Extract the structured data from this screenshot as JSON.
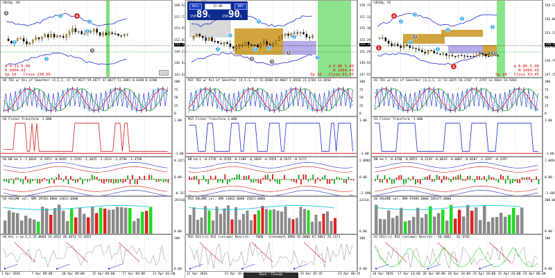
{
  "charts": [
    {
      "id": "left",
      "title": "GOLDg, H4",
      "main_prices": [
        "160.621",
        "157.730",
        "154.922",
        "152.073",
        "149.215",
        "146.425",
        "143.627"
      ],
      "current_price": "151.974",
      "overlay_left": [
        "$ 0.11 5.00",
        "H 1004.43",
        "Sp 10   Close 238.65"
      ],
      "overlay_right": [],
      "panes": [
        {
          "title": "H4 TDI w/ Rsi of Smoother (4,1,1, 3) 52.9677 59.4677 47.0677 51.2001 0.8200 0.6700",
          "scale": [
            "100",
            "75",
            "50",
            "25",
            "0"
          ]
        },
        {
          "title": "H4 Fisher Transform  -1.000",
          "scale": [
            "1.00",
            "-1.00"
          ]
        },
        {
          "title": "H4 BB km 1  -1.0941 -0.1951 -0.9495 -1.2292 -1.3825 -1.3523 -1.4796 -1.4796",
          "scale": [
            "0.3277",
            "0.00",
            "-0.3277"
          ]
        },
        {
          "title": "H4 VOLUME vol: SMA 29703.0000 33613.0000",
          "scale": [
            "397430.00",
            "0.00"
          ]
        },
        {
          "title": "H4 Rsi + sw 1,1 35.0000 54.4652 48.4652 52.4652",
          "scale": [
            "100",
            "0.00"
          ]
        }
      ],
      "time_labels": [
        "1 Apr 2026",
        "7 Apr 09:00",
        "10 Apr 09:00",
        "15 Apr 09:00",
        "17 Apr 09:00",
        "21 Apr 01:00"
      ]
    },
    {
      "id": "middle",
      "title": "GOLDg, M15",
      "main_prices": [
        "159.756",
        "157.130",
        "155.105",
        "153.290",
        "151.290",
        "149.915",
        "147.974"
      ],
      "current_price": "151.290",
      "overlay_left": [],
      "overlay_right": [
        "$ 0.86 5.00",
        "H 1004.43",
        "Sp 10   Close 63.45"
      ],
      "panes": [
        {
          "title": "M15 TDI w/ Rsi of Smoother (4,1,1, 3) 52.0588 42.0667 1.0556 21.6704 32.6950",
          "scale": [
            "100",
            "75",
            "50",
            "25",
            "0"
          ]
        },
        {
          "title": "M15 Fisher Transform  1.000",
          "scale": [
            "1.00",
            "-1.00"
          ]
        },
        {
          "title": "BB km 1  -0.2759 -0.3539 -0.1389 -0.3669 -0.5959 -0.5672 -0.5272",
          "scale": [
            "2.0902",
            "0.00",
            "-2.0902"
          ]
        },
        {
          "title": "M15 VOLUME vol: SMA 14662.0000 15021.0000",
          "scale": [
            "22154.00",
            "0.00"
          ]
        },
        {
          "title": "M15 RSI(rs) RSI (volume) Bearish: - TWOB - Greenmath EMDO 95.0000 67.9667 70.1171",
          "scale": [
            "100",
            "0.00"
          ]
        }
      ],
      "time_labels": [
        "22 Apr 2026",
        "22 Apr 16:45",
        "22 Apr 20:45",
        "23 Apr 01:45",
        "23 Apr 06:45"
      ],
      "trade_panel": {
        "sell_label": "SELL",
        "buy_label": "BUY",
        "lot": "12.00",
        "sell_prefix": "158",
        "sell_big": "89",
        "sell_sup": "1",
        "buy_prefix": "158",
        "buy_big": "90",
        "buy_sup": "1"
      },
      "tooltip": "Stick -- Change"
    },
    {
      "id": "right",
      "title": "GOLDg, H1",
      "main_prices": [
        "159.175",
        "156.005",
        "153.290",
        "151.290",
        "149.795",
        "147.150"
      ],
      "current_price": "150.415",
      "overlay_left": [],
      "overlay_right": [
        "$ 0.86 5.00",
        "H 1004.43",
        "Sp 10   Close 53.45"
      ],
      "panes": [
        {
          "title": "H1 TDI w/ Rsi of Smoother (4,1,1, 3) 53.1075 50.2707 -7.2797 12.9034 54.9364",
          "scale": [
            "100",
            "75",
            "50",
            "25",
            "0"
          ]
        },
        {
          "title": "H1 Fisher Transform  -1.000",
          "scale": [
            "1.00",
            "-1.00"
          ]
        },
        {
          "title": "BB km 1  -0.4780 -0.8955 -0.2239 -0.0633 -0.0007 -0.0507 -1.3397 -0.3297",
          "scale": [
            "2.0697",
            "0.00",
            "-2.0697"
          ]
        },
        {
          "title": "H4 VOLUME vol: SMA 97094.0000 105477.0000",
          "scale": [
            "200.00",
            "0.00"
          ]
        },
        {
          "title": "H1 RSI(rs) RSI (volume) Bearish - 58.4882 - 62.9701",
          "scale": [
            "100",
            "0.00"
          ]
        }
      ],
      "time_labels": [
        "16 Apr 2026",
        "17 Apr 13:00",
        "20 Apr 08:00",
        "20 Apr 18:00",
        "21 Apr 18:00",
        "22 Apr 20:00",
        "23 Apr 06:00"
      ]
    }
  ],
  "markers": {
    "red": [
      "4",
      "1",
      "1",
      "4"
    ],
    "blue_sample": "2",
    "gray_sample": "3"
  },
  "colors": {
    "candle_up": "#e8a11a",
    "candle_down": "#000000",
    "band_blue": "#1a2bd6",
    "band_cyan": "#18c8e0",
    "tdi_green": "#12a512",
    "tdi_red": "#d81a1a",
    "zone_tan": "#c9941f",
    "zone_purple": "#a99fe6",
    "vol_gray": "#8a8a8a",
    "vol_green": "#22d922",
    "vol_red": "#e22020",
    "future_green": "#7fe07f"
  }
}
